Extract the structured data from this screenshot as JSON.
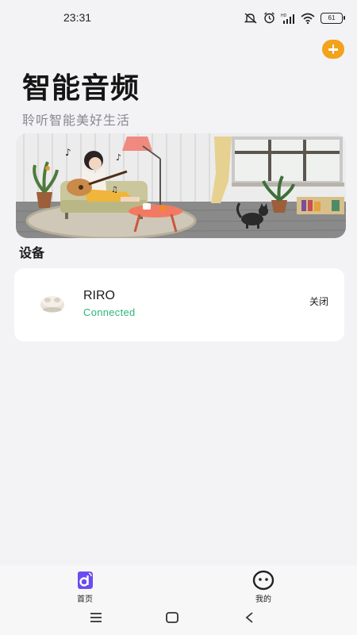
{
  "status_bar": {
    "time": "23:31",
    "battery": "61",
    "icons": [
      "mute-icon",
      "alarm-icon",
      "hd-signal-icon",
      "wifi-icon",
      "battery-icon"
    ]
  },
  "header": {
    "add_icon": "plus-icon",
    "title": "智能音频",
    "subtitle": "聆听智能美好生活"
  },
  "section": {
    "devices_title": "设备"
  },
  "devices": [
    {
      "name": "RIRO",
      "status": "Connected",
      "action": "关闭"
    }
  ],
  "tab_bar": {
    "home_label": "首页",
    "mine_label": "我的"
  },
  "colors": {
    "accent": "#f2a21b",
    "connected": "#2fb57d",
    "tab_active": "#6a4cf0",
    "background": "#f3f3f6"
  },
  "system_nav": [
    "menu-icon",
    "home-square-icon",
    "back-icon"
  ]
}
